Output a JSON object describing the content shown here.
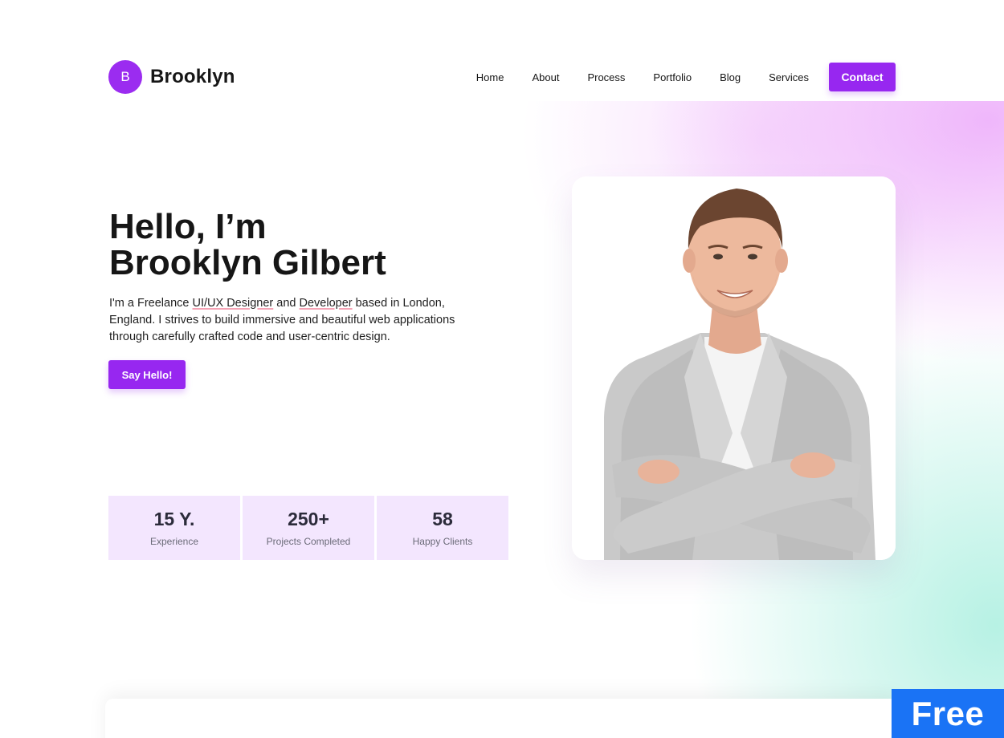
{
  "brand": {
    "initial": "B",
    "name": "Brooklyn"
  },
  "nav": {
    "items": [
      {
        "label": "Home"
      },
      {
        "label": "About"
      },
      {
        "label": "Process"
      },
      {
        "label": "Portfolio"
      },
      {
        "label": "Blog"
      },
      {
        "label": "Services"
      }
    ],
    "cta_label": "Contact"
  },
  "hero": {
    "title_line1": "Hello, I’m",
    "title_line2": "Brooklyn Gilbert",
    "desc_part1": "I'm a Freelance ",
    "desc_highlight1": "UI/UX Designer",
    "desc_part2": " and ",
    "desc_highlight2": "Developer",
    "desc_part3": " based in London, England. I strives to build immersive and beautiful web applications through carefully crafted code and user-centric design.",
    "cta_label": "Say Hello!"
  },
  "stats": [
    {
      "value": "15 Y.",
      "label": "Experience"
    },
    {
      "value": "250+",
      "label": "Projects Completed"
    },
    {
      "value": "58",
      "label": "Happy Clients"
    }
  ],
  "badge": {
    "label": "Free"
  },
  "colors": {
    "accent": "#9727f0",
    "stat_bg": "#f3e6fe",
    "badge_bg": "#1a73f5",
    "highlight_underline": "#f5a3b5"
  }
}
